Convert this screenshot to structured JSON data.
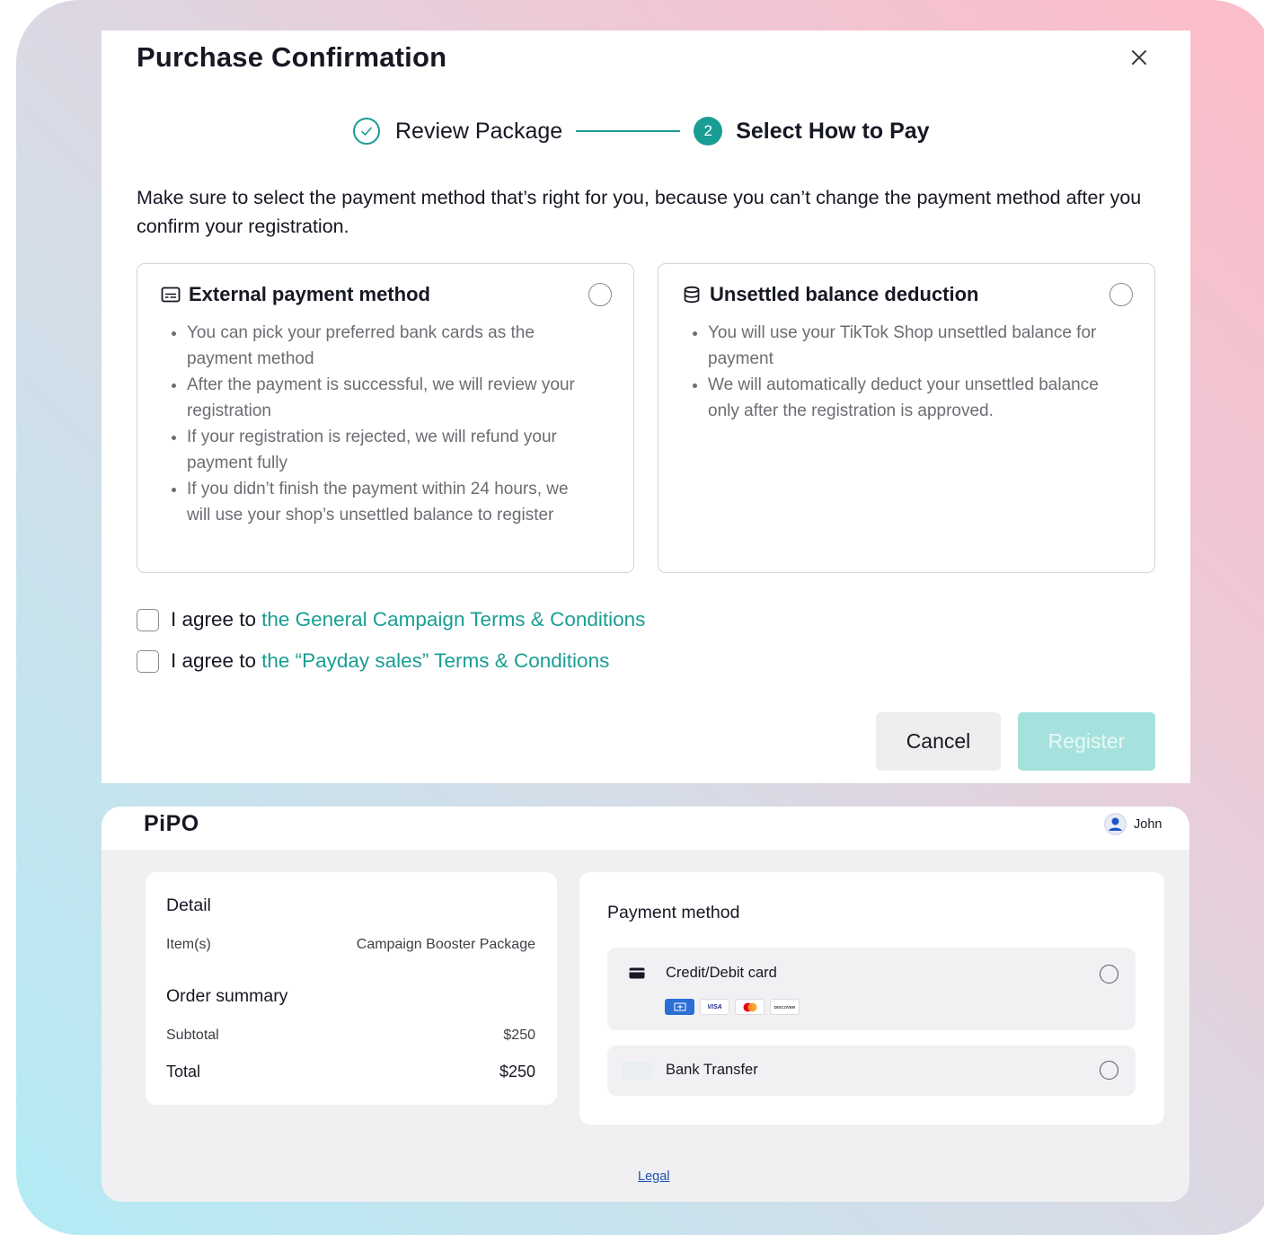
{
  "modal": {
    "title": "Purchase Confirmation",
    "steps": [
      {
        "label": "Review Package",
        "status": "completed"
      },
      {
        "number": "2",
        "label": "Select How to Pay",
        "status": "active"
      }
    ],
    "intro": "Make sure to select the payment method that’s right for you, because you can’t change the payment method after you confirm your registration.",
    "options": [
      {
        "title": "External payment method",
        "icon": "payment-card-icon",
        "bullets": [
          "You can pick your preferred bank cards as the payment method",
          "After the payment is successful, we will review your registration",
          "If your registration is rejected, we will refund your payment fully",
          "If you didn’t finish the payment within 24 hours, we will use your shop’s unsettled balance to register"
        ]
      },
      {
        "title": "Unsettled balance deduction",
        "icon": "database-icon",
        "bullets": [
          "You will use your TikTok Shop unsettled balance for payment",
          "We will automatically deduct your unsettled balance only after the registration is approved."
        ]
      }
    ],
    "agreements": [
      {
        "prefix": "I agree to",
        "link": "the General Campaign Terms & Conditions"
      },
      {
        "prefix": "I agree to",
        "link": "the “Payday sales” Terms & Conditions"
      }
    ],
    "cancel_label": "Cancel",
    "register_label": "Register",
    "accent_color": "#1a9d94"
  },
  "pipo": {
    "logo": "PiPO",
    "user_name": "John",
    "detail": {
      "title": "Detail",
      "item_label": "Item(s)",
      "item_value": "Campaign Booster Package"
    },
    "order_summary": {
      "title": "Order summary",
      "subtotal_label": "Subtotal",
      "subtotal_value": "$250",
      "total_label": "Total",
      "total_value": "$250"
    },
    "payment": {
      "title": "Payment method",
      "options": [
        {
          "label": "Credit/Debit card",
          "brands": [
            "amex",
            "VISA",
            "mastercard",
            "DISCOVER"
          ]
        },
        {
          "label": "Bank Transfer"
        }
      ]
    },
    "legal_label": "Legal"
  }
}
